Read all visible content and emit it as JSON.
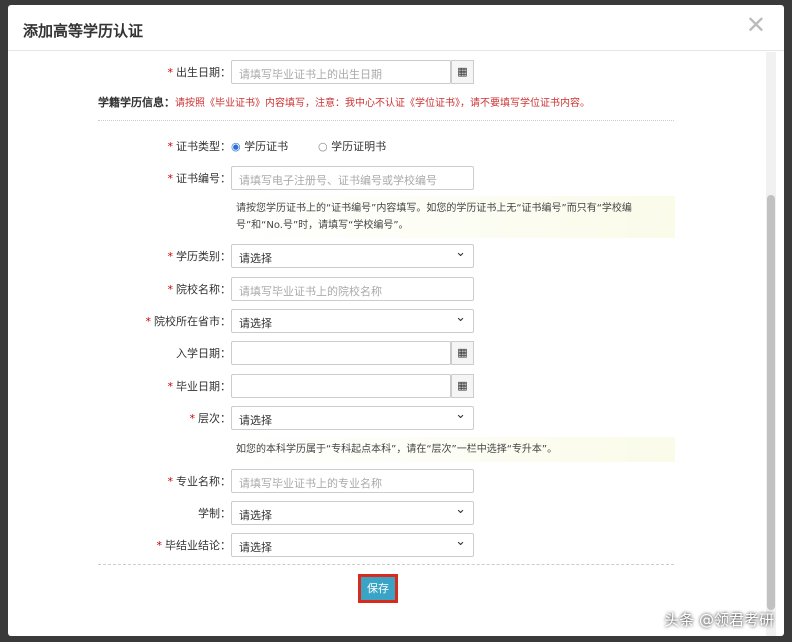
{
  "title": "添加高等学历认证",
  "close": "✕",
  "info": {
    "label": "学籍学历信息：",
    "text": "请按照《毕业证书》内容填写，注意：我中心不认证《学位证书》，请不要填写学位证书内容。"
  },
  "fields": {
    "birth": {
      "label": "出生日期：",
      "placeholder": "请填写毕业证书上的出生日期"
    },
    "cert_type": {
      "label": "证书类型：",
      "opt1": "学历证书",
      "opt2": "学历证明书"
    },
    "cert_no": {
      "label": "证书编号：",
      "placeholder": "请填写电子注册号、证书编号或学校编号",
      "hint": "请按您学历证书上的“证书编号”内容填写。如您的学历证书上无“证书编号”而只有“学校编号”和“No.号”时，请填写“学校编号”。"
    },
    "category": {
      "label": "学历类别：",
      "value": "请选择"
    },
    "school": {
      "label": "院校名称：",
      "placeholder": "请填写毕业证书上的院校名称"
    },
    "province": {
      "label": "院校所在省市：",
      "value": "请选择"
    },
    "entry": {
      "label": "入学日期："
    },
    "grad": {
      "label": "毕业日期："
    },
    "level": {
      "label": "层次：",
      "value": "请选择",
      "hint": "如您的本科学历属于“专科起点本科”，请在“层次”一栏中选择“专升本”。"
    },
    "major": {
      "label": "专业名称：",
      "placeholder": "请填写毕业证书上的专业名称"
    },
    "system": {
      "label": "学制：",
      "value": "请选择"
    },
    "conclusion": {
      "label": "毕结业结论：",
      "value": "请选择"
    }
  },
  "required": "*",
  "calendar_icon": "▦",
  "save": "保存",
  "watermark": "头条 @领君考研"
}
